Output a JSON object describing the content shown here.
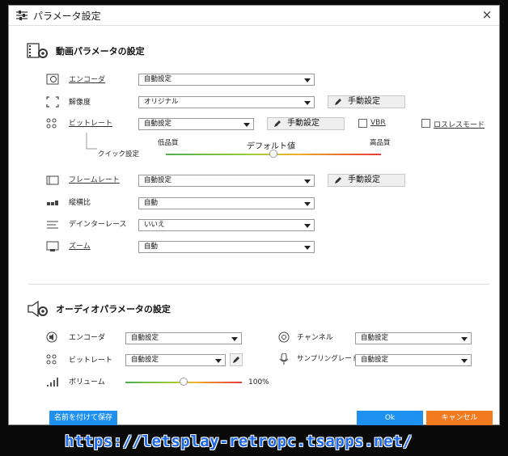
{
  "dialog": {
    "title": "パラメータ設定",
    "close_glyph": "×"
  },
  "video": {
    "section_title": "動画パラメータの設定",
    "encoder": {
      "label": "エンコーダ",
      "value": "自動設定"
    },
    "resolution": {
      "label": "解像度",
      "value": "オリジナル",
      "manual": "手動設定"
    },
    "bitrate": {
      "label": "ビットレート",
      "value": "自動設定",
      "manual": "手動設定",
      "vbr": "VBR",
      "lossless": "ロスレスモード"
    },
    "quick": {
      "label": "クイック設定",
      "low": "低品質",
      "default": "デフォルト値",
      "high": "高品質",
      "level": 0.5
    },
    "framerate": {
      "label": "フレームレート",
      "value": "自動設定",
      "manual": "手動設定"
    },
    "aspect": {
      "label": "縦横比",
      "value": "自動"
    },
    "deinterlace": {
      "label": "デインターレース",
      "value": "いいえ"
    },
    "zoom": {
      "label": "ズーム",
      "value": "自動"
    }
  },
  "audio": {
    "section_title": "オーディオパラメータの設定",
    "encoder": {
      "label": "エンコーダ",
      "value": "自動設定"
    },
    "channel": {
      "label": "チャンネル",
      "value": "自動設定"
    },
    "bitrate": {
      "label": "ビットレート",
      "value": "自動設定"
    },
    "samplerate": {
      "label": "サンプリングレート",
      "value": "自動設定"
    },
    "volume": {
      "label": "ボリューム",
      "value": "100%",
      "level": 0.5
    }
  },
  "footer": {
    "save_as": "名前を付けて保存",
    "ok": "Ok",
    "cancel": "キャンセル"
  },
  "watermark": "https://letsplay-retropc.tsapps.net/",
  "colors": {
    "ok": "#1e90f0",
    "cancel": "#f27a1f",
    "save": "#1e90f0"
  }
}
